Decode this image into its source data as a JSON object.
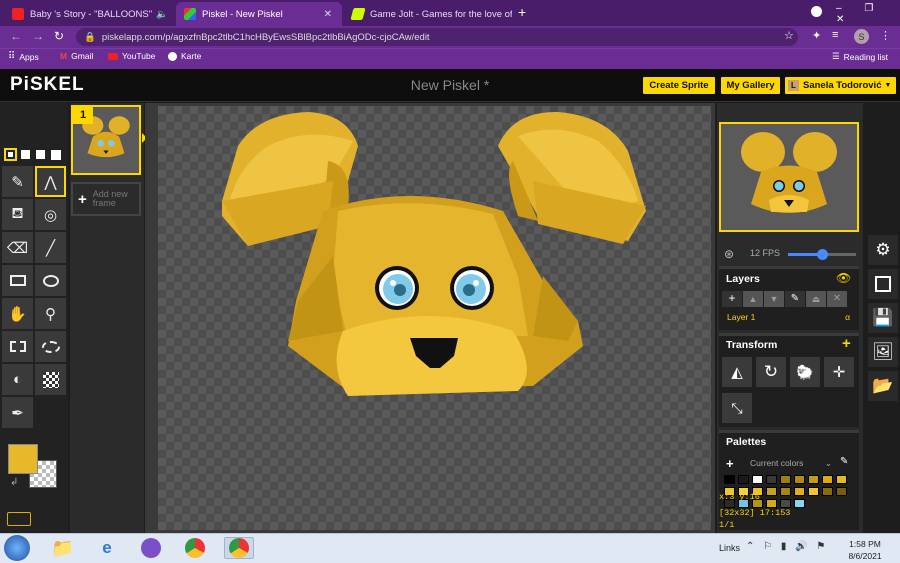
{
  "browser": {
    "tabs": [
      {
        "title": "Baby 's Story - \"BALLOONS\"",
        "active": false
      },
      {
        "title": "Piskel - New Piskel",
        "active": true
      },
      {
        "title": "Game Jolt - Games for the love of",
        "active": false
      }
    ],
    "url": "piskelapp.com/p/agxzfnBpc2tlbC1hcHByEwsSBlBpc2tlbBiAgODc-cjoCAw/edit",
    "profile_initial": "S",
    "bookmarks": [
      "Apps",
      "Gmail",
      "YouTube",
      "Karte"
    ],
    "reading_list": "Reading list"
  },
  "app": {
    "logo": "PiSKEL",
    "doc_title": "New Piskel *",
    "create_sprite": "Create Sprite",
    "my_gallery": "My Gallery",
    "user_initial": "L",
    "user_name": "Sanela Todorović"
  },
  "frames": {
    "frame_number": "1",
    "add_frame": "Add new frame"
  },
  "preview": {
    "fps_label": "12 FPS",
    "fps_value": 12
  },
  "layers": {
    "title": "Layers",
    "items": [
      {
        "name": "Layer 1",
        "opacity": "α"
      }
    ]
  },
  "transform": {
    "title": "Transform"
  },
  "palettes": {
    "title": "Palettes",
    "selected": "Current colors",
    "colors": [
      "#000000",
      "#1a1a1a",
      "#ffffff",
      "#3a3a3a",
      "#a07d10",
      "#b08a14",
      "#c89a14",
      "#d9aa1a",
      "#e8b820",
      "#f0c42a",
      "#f8d040",
      "#f0c030",
      "#c8a020",
      "#a88418",
      "#e0b01c",
      "#f3c531",
      "#8a6a0e",
      "#7a5c0c",
      "#2a2a2a",
      "#6ec6e6",
      "#b89416",
      "#d6a818",
      "#4a4a4a",
      "#8fd4ee"
    ]
  },
  "status": {
    "coords": "x:3 y:16",
    "frame_info": "[32x32] 17:153",
    "frame_count": "1/1"
  },
  "primary_color": "#e9b82a",
  "taskbar": {
    "links": "Links",
    "time": "1:58 PM",
    "date": "8/6/2021"
  },
  "side_tools": [
    "settings-icon",
    "resize-icon",
    "save-icon",
    "export-image-icon",
    "import-folder-icon"
  ]
}
